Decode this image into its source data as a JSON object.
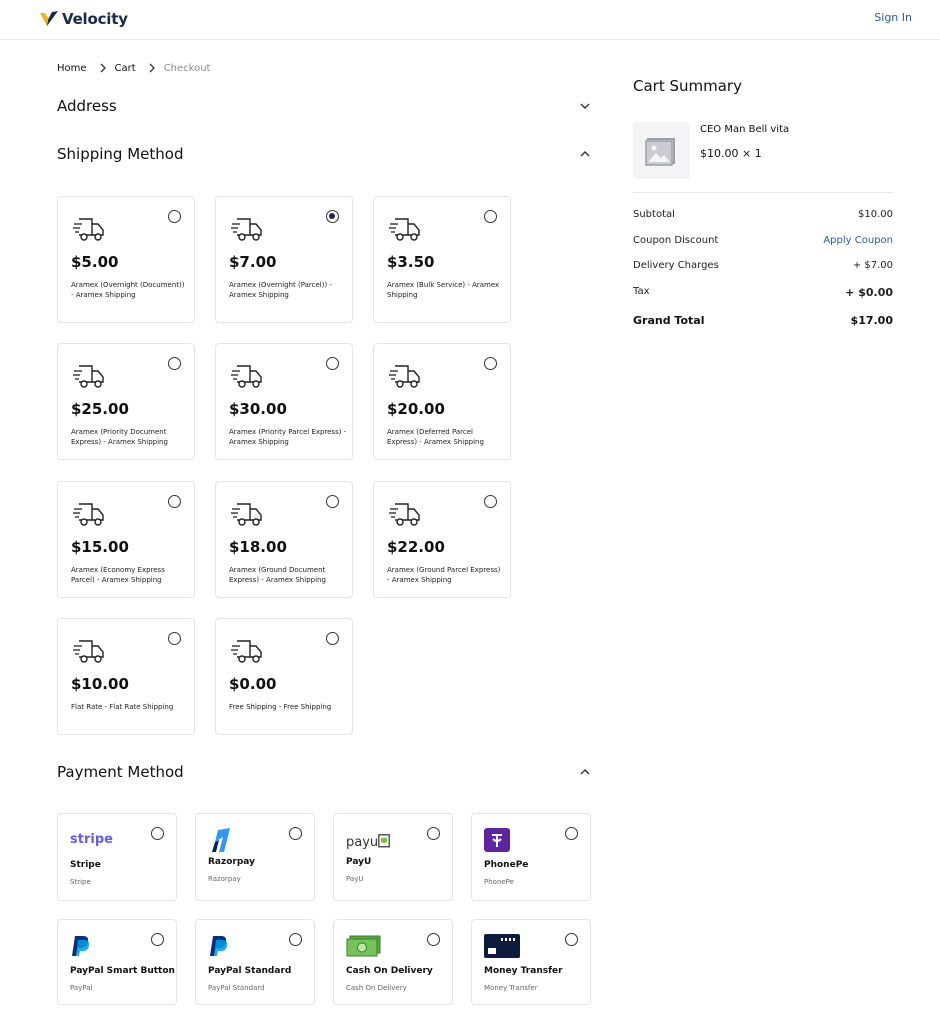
{
  "header": {
    "brand": "Velocity",
    "sign_in": "Sign In"
  },
  "breadcrumb": [
    "Home",
    "Cart",
    "Checkout"
  ],
  "sections": {
    "address": "Address",
    "shipping": "Shipping Method",
    "payment": "Payment Method"
  },
  "shipping_methods": [
    {
      "price": "$5.00",
      "desc": "Aramex (Overnight (Document)) - Aramex Shipping",
      "selected": false
    },
    {
      "price": "$7.00",
      "desc": "Aramex (Overnight (Parcel)) - Aramex Shipping",
      "selected": true
    },
    {
      "price": "$3.50",
      "desc": "Aramex (Bulk Service) - Aramex Shipping",
      "selected": false
    },
    {
      "price": "$25.00",
      "desc": "Aramex (Priority Document Express) - Aramex Shipping",
      "selected": false
    },
    {
      "price": "$30.00",
      "desc": "Aramex (Priority Parcel Express) - Aramex Shipping",
      "selected": false
    },
    {
      "price": "$20.00",
      "desc": "Aramex (Deferred Parcel Express) - Aramex Shipping",
      "selected": false
    },
    {
      "price": "$15.00",
      "desc": "Aramex (Economy Express Parcel) - Aramex Shipping",
      "selected": false
    },
    {
      "price": "$18.00",
      "desc": "Aramex (Ground Document Express) - Aramex Shipping",
      "selected": false
    },
    {
      "price": "$22.00",
      "desc": "Aramex (Ground Parcel Express) - Aramex Shipping",
      "selected": false
    },
    {
      "price": "$10.00",
      "desc": "Flat Rate - Flat Rate Shipping",
      "selected": false
    },
    {
      "price": "$0.00",
      "desc": "Free Shipping - Free Shipping",
      "selected": false
    }
  ],
  "payment_methods": [
    {
      "title": "Stripe",
      "sub": "Stripe",
      "icon": "stripe-logo",
      "logo_text": "stripe"
    },
    {
      "title": "Razorpay",
      "sub": "Razorpay",
      "icon": "razorpay-logo"
    },
    {
      "title": "PayU",
      "sub": "PayU",
      "icon": "payu-logo",
      "logo_text": "payu"
    },
    {
      "title": "PhonePe",
      "sub": "PhonePe",
      "icon": "phonepe-logo"
    },
    {
      "title": "PayPal Smart Button",
      "sub": "PayPal",
      "icon": "paypal-logo"
    },
    {
      "title": "PayPal Standard",
      "sub": "PayPal Standard",
      "icon": "paypal-logo"
    },
    {
      "title": "Cash On Delivery",
      "sub": "Cash On Delivery",
      "icon": "cash-icon"
    },
    {
      "title": "Money Transfer",
      "sub": "Money Transfer",
      "icon": "card-icon"
    }
  ],
  "summary": {
    "title": "Cart Summary",
    "product_name": "CEO Man Bell vita",
    "product_price": "$10.00 × 1",
    "subtotal_label": "Subtotal",
    "subtotal_value": "$10.00",
    "coupon_label": "Coupon Discount",
    "coupon_action": "Apply Coupon",
    "delivery_label": "Delivery Charges",
    "delivery_value": "+ $7.00",
    "tax_label": "Tax",
    "tax_value": "+ $0.00",
    "total_label": "Grand Total",
    "total_value": "$17.00"
  },
  "colors": {
    "brand": "#1b2a4a",
    "link": "#2c5aa0",
    "logo_accent": "#f2b21b"
  }
}
